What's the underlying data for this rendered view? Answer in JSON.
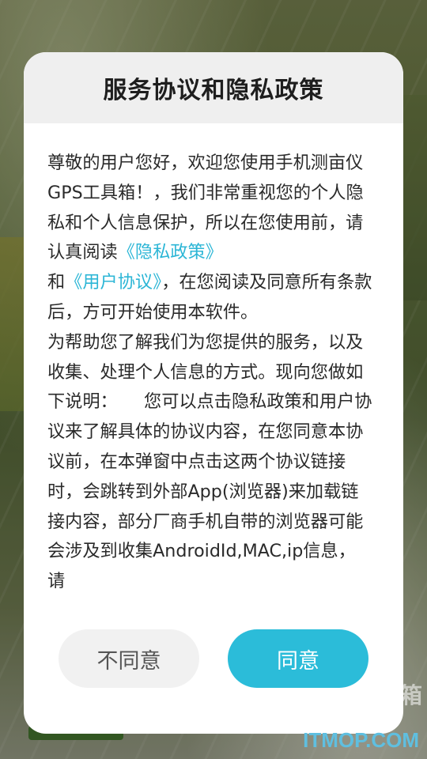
{
  "dialog": {
    "title": "服务协议和隐私政策",
    "body": {
      "p1_text_a": "尊敬的用户您好，欢迎您使用手机测亩仪GPS工具箱！，我们非常重视您的个人隐私和个人信息保护，所以在您使用前，请认真阅读",
      "privacy_link": "《隐私政策》",
      "p1_text_b": "和",
      "user_agreement_link": "《用户协议》",
      "p1_text_c": "，在您阅读及同意所有条款后，方可开始使用本软件。",
      "p2_text": "为帮助您了解我们为您提供的服务，以及收集、处理个人信息的方式。现向您做如下说明：　　您可以点击隐私政策和用户协议来了解具体的协议内容，在您同意本协议前，在本弹窗中点击这两个协议链接时，会跳转到外部App(浏览器)来加载链接内容，部分厂商手机自带的浏览器可能会涉及到收集AndroidId,MAC,ip信息，请"
    },
    "buttons": {
      "disagree_label": "不同意",
      "agree_label": "同意"
    }
  },
  "background": {
    "edge_char": "箱"
  },
  "watermark": "ITMOP.COM",
  "colors": {
    "accent": "#2bbcd9",
    "link": "#2cb6d6",
    "disagree_bg": "#f1f1f1",
    "header_bg": "#efefef"
  }
}
